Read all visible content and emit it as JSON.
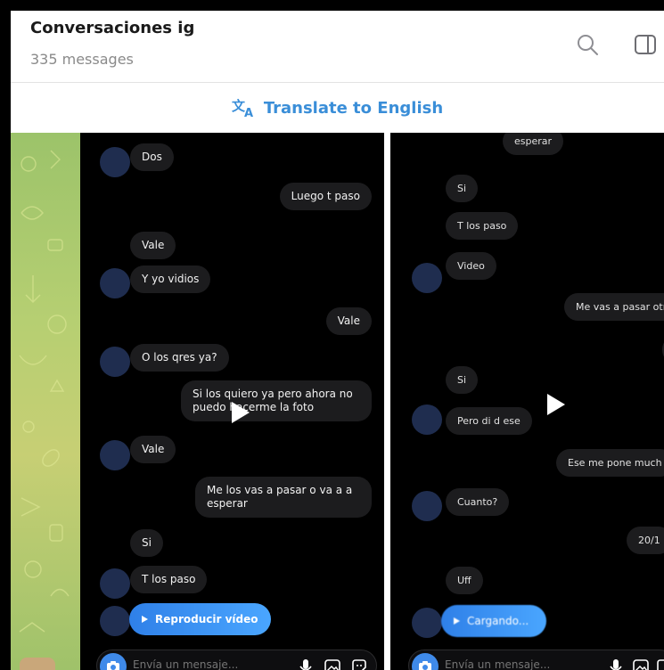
{
  "header": {
    "title": "Conversaciones ig",
    "subtitle": "335 messages"
  },
  "translate": {
    "label": "Translate to English"
  },
  "left_chat": {
    "messages": [
      {
        "side": "in",
        "text": "Dos"
      },
      {
        "side": "out",
        "text": "Luego t paso"
      },
      {
        "side": "in",
        "text": "Vale"
      },
      {
        "side": "in",
        "text": "Y yo vidios"
      },
      {
        "side": "out",
        "text": "Vale"
      },
      {
        "side": "in",
        "text": "O los qres ya?"
      },
      {
        "side": "out",
        "text": "Si los quiero ya pero ahora no puedo hacerme la foto"
      },
      {
        "side": "in",
        "text": "Vale"
      },
      {
        "side": "out",
        "text": "Me los vas a pasar o va a a esperar"
      },
      {
        "side": "in",
        "text": "Si"
      },
      {
        "side": "in",
        "text": "T los paso"
      }
    ],
    "video_button": "Reproducir vídeo",
    "composer_placeholder": "Envía un mensaje..."
  },
  "right_chat": {
    "messages": [
      {
        "side": "in",
        "text": "esperar"
      },
      {
        "side": "in",
        "text": "Si"
      },
      {
        "side": "in",
        "text": "T los paso"
      },
      {
        "side": "in",
        "text": "Video"
      },
      {
        "side": "out",
        "text": "Me vas a pasar otr"
      },
      {
        "side": "in",
        "text": "Si"
      },
      {
        "side": "in",
        "text": "Pero di d ese"
      },
      {
        "side": "out",
        "text": "Ese me pone much"
      },
      {
        "side": "in",
        "text": "Cuanto?"
      },
      {
        "side": "out",
        "text": "20/1"
      },
      {
        "side": "in",
        "text": "Uff"
      }
    ],
    "video_button": "Cargando...",
    "composer_placeholder": "Envía un mensaje..."
  },
  "icons": {
    "search": "search-icon",
    "sidebar": "sidebar-toggle-icon",
    "translate": "translate-icon",
    "play": "play-icon",
    "camera": "camera-icon",
    "mic": "microphone-icon",
    "gallery": "image-icon",
    "sticker": "sticker-icon"
  },
  "colors": {
    "accent": "#3a8ed8",
    "bubble": "#1c1c1e",
    "avatar": "#1f2d4f",
    "video_button": "#3b8ff0"
  }
}
